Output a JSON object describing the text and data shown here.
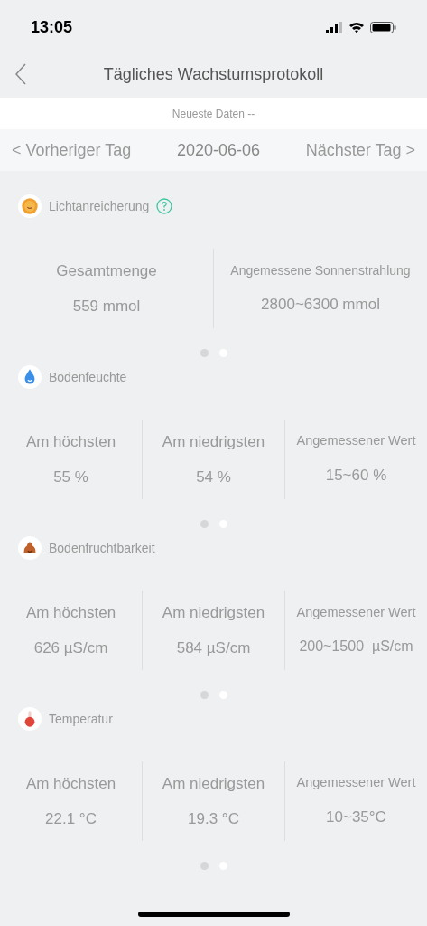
{
  "status_bar": {
    "time": "13:05"
  },
  "nav": {
    "title": "Tägliches Wachstumsprotokoll"
  },
  "latest": "Neueste Daten --",
  "date_bar": {
    "prev": "< Vorheriger Tag",
    "date": "2020-06-06",
    "next": "Nächster Tag >"
  },
  "sections": [
    {
      "kind": "sun",
      "title": "Lichtanreicherung",
      "help": true,
      "stats": [
        {
          "label": "Gesamtmenge",
          "value": "559 mmol"
        },
        {
          "label": "Angemessene Sonnenstrahlung",
          "value": "2800~6300 mmol"
        }
      ],
      "pages": [
        {
          "selected": true
        },
        {
          "selected": false
        }
      ]
    },
    {
      "kind": "drop",
      "title": "Bodenfeuchte",
      "help": false,
      "stats": [
        {
          "label": "Am höchsten",
          "value": "55 %"
        },
        {
          "label": "Am niedrigsten",
          "value": "54 %"
        },
        {
          "label": "Angemessener Wert",
          "value": "15~60 %"
        }
      ],
      "pages": [
        {
          "selected": true
        },
        {
          "selected": false
        }
      ]
    },
    {
      "kind": "soil",
      "title": "Bodenfruchtbarkeit",
      "help": false,
      "stats": [
        {
          "label": "Am höchsten",
          "value": "626 µS/cm"
        },
        {
          "label": "Am niedrigsten",
          "value": "584 µS/cm"
        },
        {
          "label": "Angemessener Wert",
          "value": "200~1500  µS/cm"
        }
      ],
      "pages": [
        {
          "selected": true
        },
        {
          "selected": false
        }
      ]
    },
    {
      "kind": "thermo",
      "title": "Temperatur",
      "help": false,
      "stats": [
        {
          "label": "Am höchsten",
          "value": "22.1 °C"
        },
        {
          "label": "Am niedrigsten",
          "value": "19.3 °C"
        },
        {
          "label": "Angemessener Wert",
          "value": "10~35°C"
        }
      ],
      "pages": [
        {
          "selected": true
        },
        {
          "selected": false
        }
      ]
    }
  ]
}
